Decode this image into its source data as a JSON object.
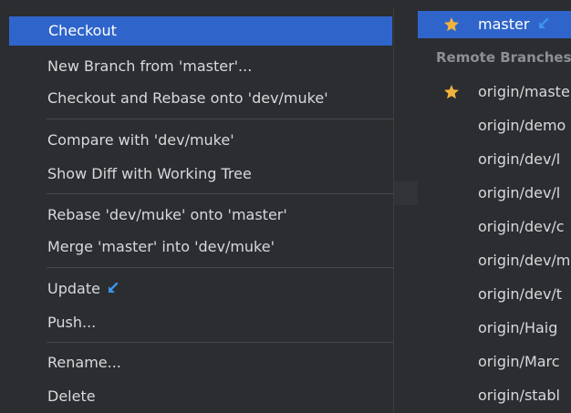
{
  "menu": {
    "items": [
      {
        "label": "Checkout"
      },
      {
        "label": "New Branch from 'master'..."
      },
      {
        "label": "Checkout and Rebase onto 'dev/muke'"
      },
      {
        "label": "Compare with 'dev/muke'"
      },
      {
        "label": "Show Diff with Working Tree"
      },
      {
        "label": "Rebase 'dev/muke' onto 'master'"
      },
      {
        "label": "Merge 'master' into 'dev/muke'"
      },
      {
        "label": "Update"
      },
      {
        "label": "Push..."
      },
      {
        "label": "Rename..."
      },
      {
        "label": "Delete"
      }
    ],
    "update_icon": "incoming-arrow-icon"
  },
  "branches": {
    "current": {
      "name": "master",
      "icon": "favorite-star-icon",
      "badge_icon": "incoming-arrow-icon"
    },
    "remote_header": "Remote Branches",
    "remote": [
      {
        "name": "origin/master",
        "favorite": true
      },
      {
        "name": "origin/demo"
      },
      {
        "name": "origin/dev/l"
      },
      {
        "name": "origin/dev/l"
      },
      {
        "name": "origin/dev/c"
      },
      {
        "name": "origin/dev/m"
      },
      {
        "name": "origin/dev/t"
      },
      {
        "name": "origin/Haig"
      },
      {
        "name": "origin/Marc"
      },
      {
        "name": "origin/stabl"
      }
    ]
  },
  "colors": {
    "background": "#2b2d30",
    "selection": "#2f65ca",
    "text": "#d8d9dc",
    "star": "#f2b33d",
    "arrow": "#3d94e8"
  }
}
